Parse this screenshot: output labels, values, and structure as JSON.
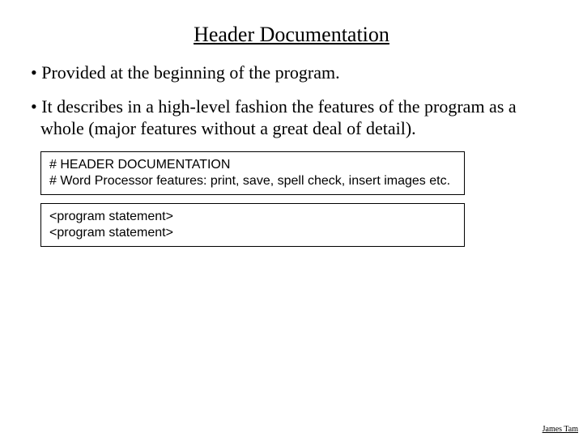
{
  "title": "Header Documentation",
  "bullets": [
    "Provided at the beginning of the program.",
    "It describes in a high-level fashion the features of the program as a whole (major features without a great deal of detail)."
  ],
  "codebox1": {
    "line1": "# HEADER DOCUMENTATION",
    "line2": "# Word Processor features: print, save, spell check, insert images etc."
  },
  "codebox2": {
    "line1": "<program statement>",
    "line2": "<program statement>"
  },
  "author": "James Tam"
}
